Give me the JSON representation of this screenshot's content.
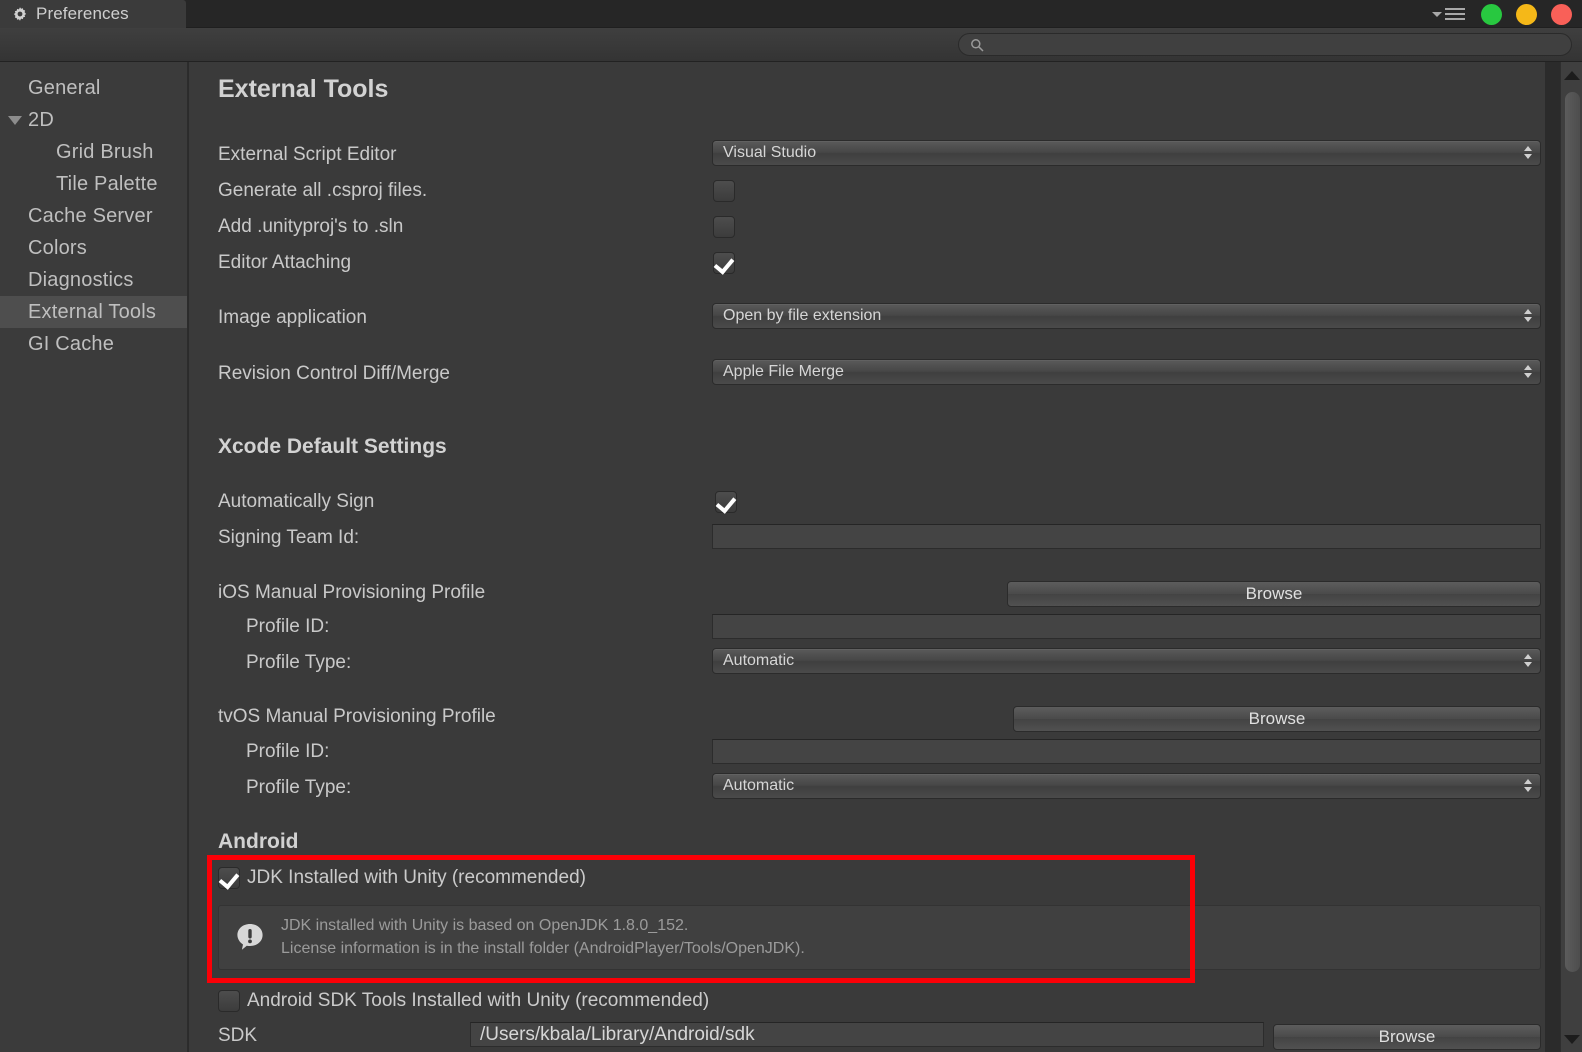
{
  "window": {
    "tab_label": "Preferences",
    "tab_icon": "gear-icon",
    "controls": {
      "menu_icon": "menu-filter-icon",
      "green": "#28c840",
      "yellow": "#f5b818",
      "red": "#f96058"
    }
  },
  "toolbar": {
    "search_icon": "search-icon",
    "search_value": "",
    "search_placeholder": ""
  },
  "sidebar": {
    "items": [
      {
        "label": "General",
        "indent": false,
        "arrow": false,
        "selected": false
      },
      {
        "label": "2D",
        "indent": false,
        "arrow": true,
        "selected": false
      },
      {
        "label": "Grid Brush",
        "indent": true,
        "arrow": false,
        "selected": false
      },
      {
        "label": "Tile Palette",
        "indent": true,
        "arrow": false,
        "selected": false
      },
      {
        "label": "Cache Server",
        "indent": false,
        "arrow": false,
        "selected": false
      },
      {
        "label": "Colors",
        "indent": false,
        "arrow": false,
        "selected": false
      },
      {
        "label": "Diagnostics",
        "indent": false,
        "arrow": false,
        "selected": false
      },
      {
        "label": "External Tools",
        "indent": false,
        "arrow": false,
        "selected": true
      },
      {
        "label": "GI Cache",
        "indent": false,
        "arrow": false,
        "selected": false
      }
    ]
  },
  "main": {
    "page_title": "External Tools",
    "external_script_editor": {
      "label": "External Script Editor",
      "value": "Visual Studio"
    },
    "generate_csproj": {
      "label": "Generate all .csproj files.",
      "checked": false
    },
    "add_unityproj": {
      "label": "Add .unityproj's to .sln",
      "checked": false
    },
    "editor_attaching": {
      "label": "Editor Attaching",
      "checked": true
    },
    "image_application": {
      "label": "Image application",
      "value": "Open by file extension"
    },
    "revision_control": {
      "label": "Revision Control Diff/Merge",
      "value": "Apple File Merge"
    },
    "xcode_section_title": "Xcode Default Settings",
    "automatically_sign": {
      "label": "Automatically Sign",
      "checked": true
    },
    "signing_team_id": {
      "label": "Signing Team Id:",
      "value": ""
    },
    "ios_profile_title": "iOS Manual Provisioning Profile",
    "ios_browse_label": "Browse",
    "ios_profile_id": {
      "label": "Profile ID:",
      "value": ""
    },
    "ios_profile_type": {
      "label": "Profile Type:",
      "value": "Automatic"
    },
    "tvos_profile_title": "tvOS Manual Provisioning Profile",
    "tvos_browse_label": "Browse",
    "tvos_profile_id": {
      "label": "Profile ID:",
      "value": ""
    },
    "tvos_profile_type": {
      "label": "Profile Type:",
      "value": "Automatic"
    },
    "android_section_title": "Android",
    "jdk_installed": {
      "label": "JDK Installed with Unity (recommended)",
      "checked": true
    },
    "jdk_help": {
      "icon": "info-exclamation-icon",
      "line1": "JDK installed with Unity is based on OpenJDK 1.8.0_152.",
      "line2": "License information is in the install folder (AndroidPlayer/Tools/OpenJDK)."
    },
    "android_sdk_tools": {
      "label": "Android SDK Tools Installed with Unity (recommended)",
      "checked": false
    },
    "sdk_row": {
      "label": "SDK",
      "value": "/Users/kbala/Library/Android/sdk",
      "browse_label": "Browse"
    }
  },
  "annotation": {
    "highlight_color": "#fb0007"
  },
  "scrollbar": {
    "up_icon": "scroll-up-arrow-icon",
    "down_icon": "scroll-down-arrow-icon"
  }
}
